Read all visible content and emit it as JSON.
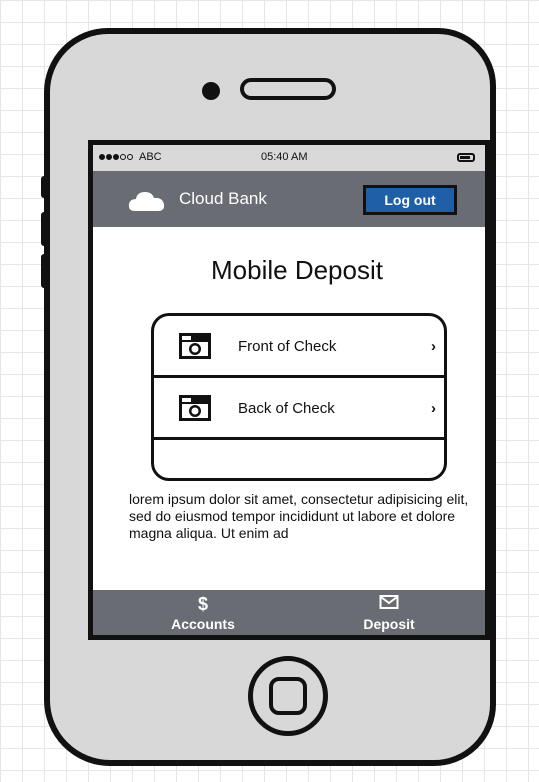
{
  "status_bar": {
    "carrier": "ABC",
    "time": "05:40 AM"
  },
  "navbar": {
    "app_name": "Cloud Bank",
    "logout_label": "Log out",
    "logout_color": "#1f5fa8",
    "bar_color": "#6a6c74"
  },
  "page": {
    "title": "Mobile Deposit"
  },
  "check_items": [
    {
      "label": "Front of Check",
      "icon": "camera-icon",
      "chevron": "›"
    },
    {
      "label": "Back of Check",
      "icon": "camera-icon",
      "chevron": "›"
    }
  ],
  "body_text": "lorem ipsum dolor sit amet, consectetur adipisicing elit, sed do eiusmod tempor incididunt ut labore et dolore magna aliqua. Ut enim ad",
  "tabbar": {
    "items": [
      {
        "label": "Accounts",
        "icon": "dollar-icon",
        "glyph": "$"
      },
      {
        "label": "Deposit",
        "icon": "envelope-icon"
      }
    ]
  }
}
